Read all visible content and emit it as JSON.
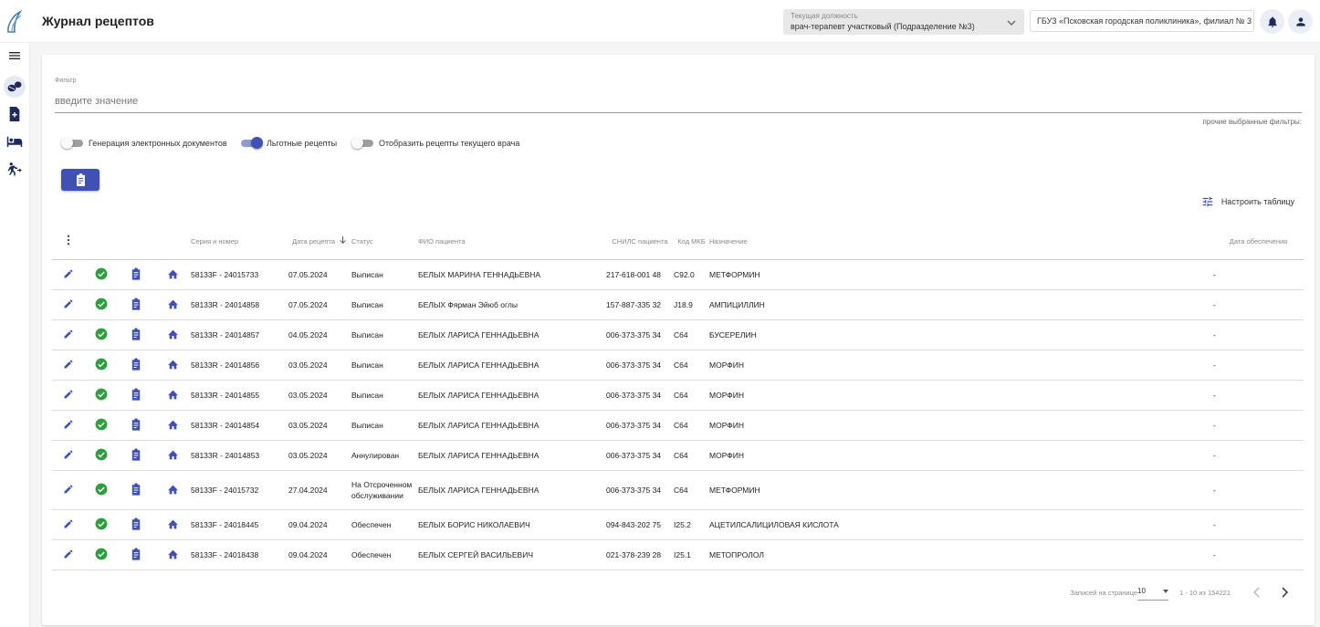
{
  "header": {
    "title": "Журнал рецептов",
    "position_label": "Текущая должность",
    "position_value": "врач-терапевт участковый (Подразделение №3)",
    "organization": "ГБУЗ «Псковская городская поликлиника», филиал № 3"
  },
  "filter": {
    "label": "Фильтр",
    "placeholder": "введите значение",
    "other_filters": "прочие выбранные фильтры:"
  },
  "toggles": [
    {
      "label": "Генерация электронных документов",
      "on": false
    },
    {
      "label": "Льготные рецепты",
      "on": true
    },
    {
      "label": "Отобразить рецепты текущего врача",
      "on": false
    }
  ],
  "config_table_label": "Настроить таблицу",
  "table": {
    "headers": {
      "series": "Серия и номер",
      "date": "Дата рецепта",
      "status": "Статус",
      "patient": "ФИО пациента",
      "snils": "СНИЛС пациента",
      "mkb": "Код МКБ",
      "drug": "Назначение",
      "supply_date": "Дата обеспечения"
    },
    "rows": [
      {
        "series": "58133F - 24015733",
        "date": "07.05.2024",
        "status": "Выписан",
        "patient": "БЕЛЫХ МАРИНА ГЕННАДЬЕВНА",
        "snils": "217-618-001 48",
        "mkb": "C92.0",
        "drug": "МЕТФОРМИН",
        "supply_date": "-"
      },
      {
        "series": "58133R - 24014858",
        "date": "07.05.2024",
        "status": "Выписан",
        "patient": "БЕЛЫХ Фярман Эйюб оглы",
        "snils": "157-887-335 32",
        "mkb": "J18.9",
        "drug": "АМПИЦИЛЛИН",
        "supply_date": "-"
      },
      {
        "series": "58133R - 24014857",
        "date": "04.05.2024",
        "status": "Выписан",
        "patient": "БЕЛЫХ ЛАРИСА ГЕННАДЬЕВНА",
        "snils": "006-373-375 34",
        "mkb": "C64",
        "drug": "БУСЕРЕЛИН",
        "supply_date": "-"
      },
      {
        "series": "58133R - 24014856",
        "date": "03.05.2024",
        "status": "Выписан",
        "patient": "БЕЛЫХ ЛАРИСА ГЕННАДЬЕВНА",
        "snils": "006-373-375 34",
        "mkb": "C64",
        "drug": "МОРФИН",
        "supply_date": "-"
      },
      {
        "series": "58133R - 24014855",
        "date": "03.05.2024",
        "status": "Выписан",
        "patient": "БЕЛЫХ ЛАРИСА ГЕННАДЬЕВНА",
        "snils": "006-373-375 34",
        "mkb": "C64",
        "drug": "МОРФИН",
        "supply_date": "-"
      },
      {
        "series": "58133R - 24014854",
        "date": "03.05.2024",
        "status": "Выписан",
        "patient": "БЕЛЫХ ЛАРИСА ГЕННАДЬЕВНА",
        "snils": "006-373-375 34",
        "mkb": "C64",
        "drug": "МОРФИН",
        "supply_date": "-"
      },
      {
        "series": "58133R - 24014853",
        "date": "03.05.2024",
        "status": "Аннулирован",
        "patient": "БЕЛЫХ ЛАРИСА ГЕННАДЬЕВНА",
        "snils": "006-373-375 34",
        "mkb": "C64",
        "drug": "МОРФИН",
        "supply_date": "-"
      },
      {
        "series": "58133F - 24015732",
        "date": "27.04.2024",
        "status": "На Отсроченном обслуживании",
        "patient": "БЕЛЫХ ЛАРИСА ГЕННАДЬЕВНА",
        "snils": "006-373-375 34",
        "mkb": "C64",
        "drug": "МЕТФОРМИН",
        "supply_date": "-"
      },
      {
        "series": "58133F - 24018445",
        "date": "09.04.2024",
        "status": "Обеспечен",
        "patient": "БЕЛЫХ БОРИС НИКОЛАЕВИЧ",
        "snils": "094-843-202 75",
        "mkb": "I25.2",
        "drug": "АЦЕТИЛСАЛИЦИЛОВАЯ КИСЛОТА",
        "supply_date": "-"
      },
      {
        "series": "58133F - 24018438",
        "date": "09.04.2024",
        "status": "Обеспечен",
        "patient": "БЕЛЫХ СЕРГЕЙ ВАСИЛЬЕВИЧ",
        "snils": "021-378-239 28",
        "mkb": "I25.1",
        "drug": "МЕТОПРОЛОЛ",
        "supply_date": "-"
      }
    ]
  },
  "paginator": {
    "label": "Записей на странице",
    "page_size": "10",
    "range": "1 - 10 из 154221"
  },
  "colors": {
    "primary": "#3f51b5",
    "success": "#2e9e3e"
  }
}
